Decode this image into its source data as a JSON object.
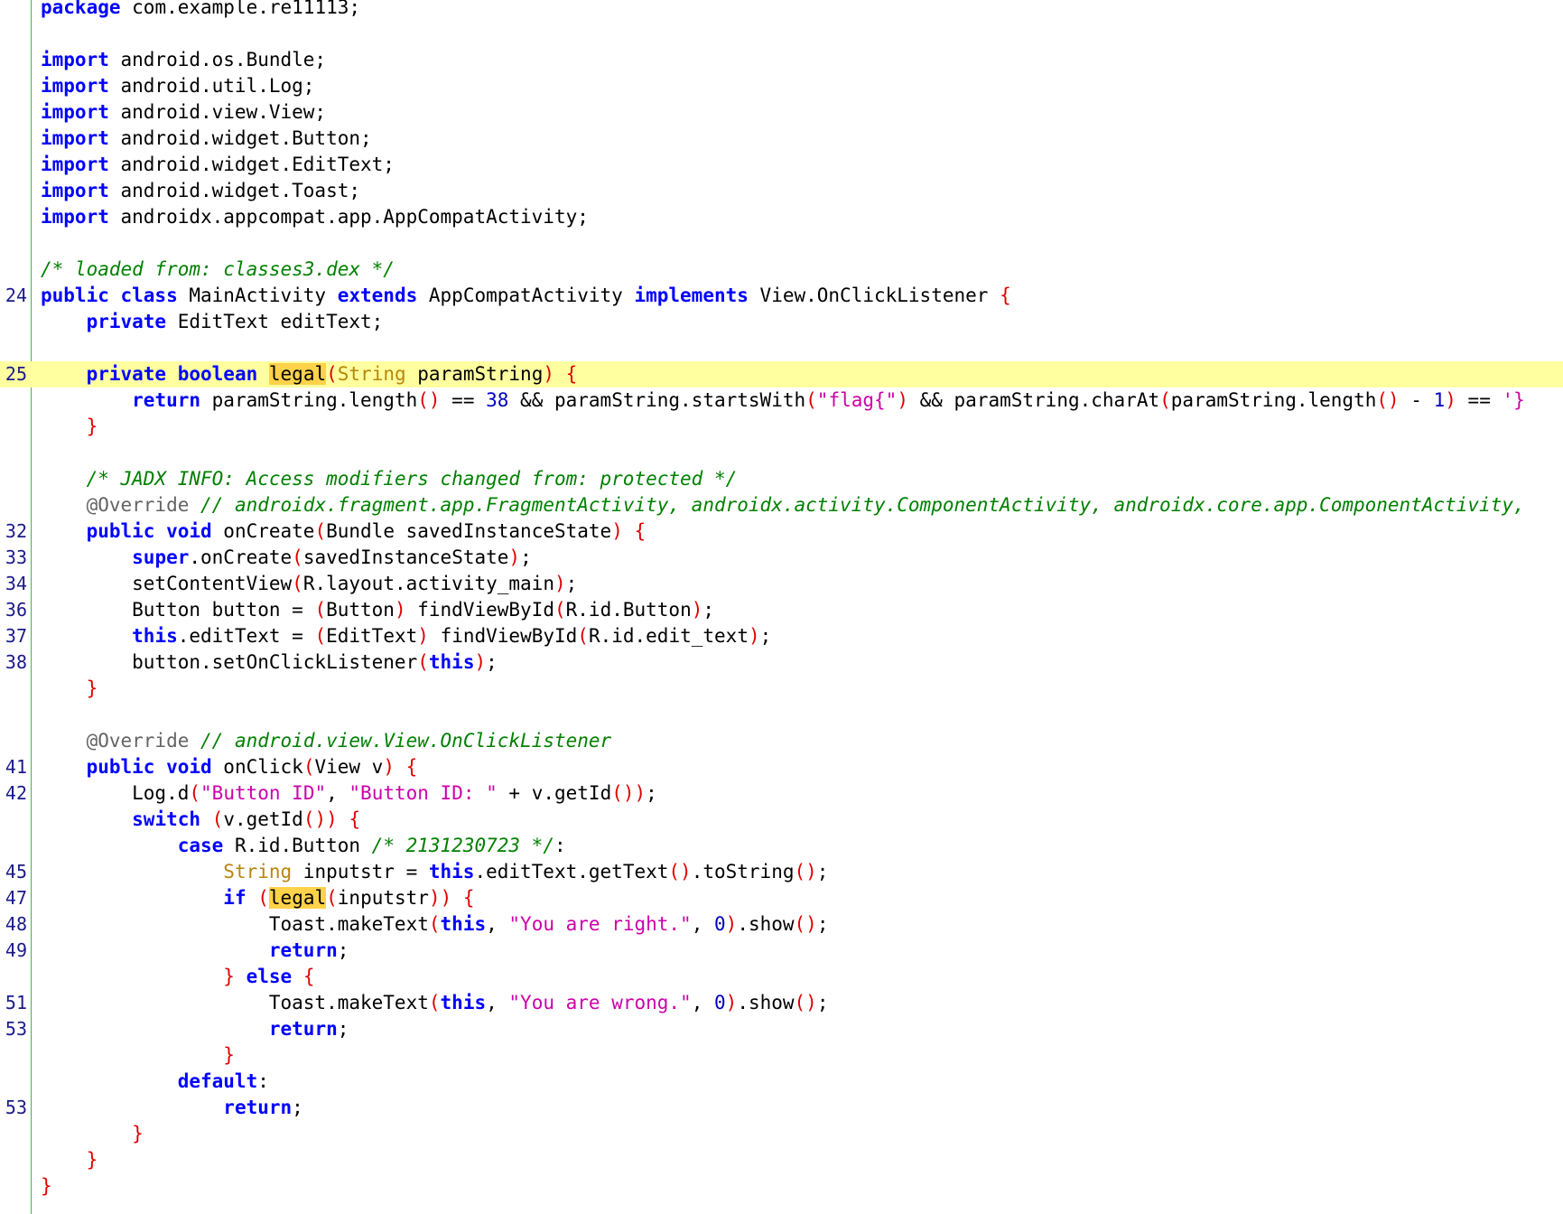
{
  "editor": {
    "lines": [
      {
        "ln": "",
        "tokens": [
          {
            "k": "kw",
            "t": "package"
          },
          {
            "k": "",
            "t": " com.example.re11113;"
          }
        ]
      },
      {
        "ln": "",
        "tokens": []
      },
      {
        "ln": "",
        "tokens": [
          {
            "k": "kw",
            "t": "import"
          },
          {
            "k": "",
            "t": " android.os.Bundle;"
          }
        ]
      },
      {
        "ln": "",
        "tokens": [
          {
            "k": "kw",
            "t": "import"
          },
          {
            "k": "",
            "t": " android.util.Log;"
          }
        ]
      },
      {
        "ln": "",
        "tokens": [
          {
            "k": "kw",
            "t": "import"
          },
          {
            "k": "",
            "t": " android.view.View;"
          }
        ]
      },
      {
        "ln": "",
        "tokens": [
          {
            "k": "kw",
            "t": "import"
          },
          {
            "k": "",
            "t": " android.widget.Button;"
          }
        ]
      },
      {
        "ln": "",
        "tokens": [
          {
            "k": "kw",
            "t": "import"
          },
          {
            "k": "",
            "t": " android.widget.EditText;"
          }
        ]
      },
      {
        "ln": "",
        "tokens": [
          {
            "k": "kw",
            "t": "import"
          },
          {
            "k": "",
            "t": " android.widget.Toast;"
          }
        ]
      },
      {
        "ln": "",
        "tokens": [
          {
            "k": "kw",
            "t": "import"
          },
          {
            "k": "",
            "t": " androidx.appcompat.app.AppCompatActivity;"
          }
        ]
      },
      {
        "ln": "",
        "tokens": []
      },
      {
        "ln": "",
        "tokens": [
          {
            "k": "cm",
            "t": "/* loaded from: classes3.dex */"
          }
        ]
      },
      {
        "ln": "24",
        "tokens": [
          {
            "k": "kw",
            "t": "public class"
          },
          {
            "k": "",
            "t": " MainActivity "
          },
          {
            "k": "kw",
            "t": "extends"
          },
          {
            "k": "",
            "t": " AppCompatActivity "
          },
          {
            "k": "kw",
            "t": "implements"
          },
          {
            "k": "",
            "t": " View.OnClickListener "
          },
          {
            "k": "br",
            "t": "{"
          }
        ]
      },
      {
        "ln": "",
        "tokens": [
          {
            "k": "",
            "t": "    "
          },
          {
            "k": "kw",
            "t": "private"
          },
          {
            "k": "",
            "t": " EditText editText;"
          }
        ]
      },
      {
        "ln": "",
        "tokens": []
      },
      {
        "ln": "25",
        "hl": true,
        "tokens": [
          {
            "k": "",
            "t": "    "
          },
          {
            "k": "kw",
            "t": "private boolean"
          },
          {
            "k": "",
            "t": " "
          },
          {
            "k": "mark",
            "t": "legal"
          },
          {
            "k": "par",
            "t": "("
          },
          {
            "k": "typ",
            "t": "String"
          },
          {
            "k": "",
            "t": " paramString"
          },
          {
            "k": "par",
            "t": ")"
          },
          {
            "k": "",
            "t": " "
          },
          {
            "k": "br",
            "t": "{"
          }
        ]
      },
      {
        "ln": "",
        "tokens": [
          {
            "k": "",
            "t": "        "
          },
          {
            "k": "kw",
            "t": "return"
          },
          {
            "k": "",
            "t": " paramString.length"
          },
          {
            "k": "par",
            "t": "()"
          },
          {
            "k": "",
            "t": " == "
          },
          {
            "k": "num",
            "t": "38"
          },
          {
            "k": "",
            "t": " && paramString.startsWith"
          },
          {
            "k": "par",
            "t": "("
          },
          {
            "k": "st",
            "t": "\"flag{\""
          },
          {
            "k": "par",
            "t": ")"
          },
          {
            "k": "",
            "t": " && paramString.charAt"
          },
          {
            "k": "par",
            "t": "("
          },
          {
            "k": "",
            "t": "paramString.length"
          },
          {
            "k": "par",
            "t": "()"
          },
          {
            "k": "",
            "t": " - "
          },
          {
            "k": "num",
            "t": "1"
          },
          {
            "k": "par",
            "t": ")"
          },
          {
            "k": "",
            "t": " == "
          },
          {
            "k": "st",
            "t": "'}"
          }
        ]
      },
      {
        "ln": "",
        "tokens": [
          {
            "k": "",
            "t": "    "
          },
          {
            "k": "br",
            "t": "}"
          }
        ]
      },
      {
        "ln": "",
        "tokens": []
      },
      {
        "ln": "",
        "tokens": [
          {
            "k": "",
            "t": "    "
          },
          {
            "k": "cm",
            "t": "/* JADX INFO: Access modifiers changed from: protected */"
          }
        ]
      },
      {
        "ln": "",
        "tokens": [
          {
            "k": "",
            "t": "    "
          },
          {
            "k": "ann",
            "t": "@Override"
          },
          {
            "k": "",
            "t": " "
          },
          {
            "k": "cm",
            "t": "// androidx.fragment.app.FragmentActivity, androidx.activity.ComponentActivity, androidx.core.app.ComponentActivity,"
          }
        ]
      },
      {
        "ln": "32",
        "tokens": [
          {
            "k": "",
            "t": "    "
          },
          {
            "k": "kw",
            "t": "public void"
          },
          {
            "k": "",
            "t": " onCreate"
          },
          {
            "k": "par",
            "t": "("
          },
          {
            "k": "",
            "t": "Bundle savedInstanceState"
          },
          {
            "k": "par",
            "t": ")"
          },
          {
            "k": "",
            "t": " "
          },
          {
            "k": "br",
            "t": "{"
          }
        ]
      },
      {
        "ln": "33",
        "tokens": [
          {
            "k": "",
            "t": "        "
          },
          {
            "k": "kw",
            "t": "super"
          },
          {
            "k": "",
            "t": ".onCreate"
          },
          {
            "k": "par",
            "t": "("
          },
          {
            "k": "",
            "t": "savedInstanceState"
          },
          {
            "k": "par",
            "t": ")"
          },
          {
            "k": "",
            "t": ";"
          }
        ]
      },
      {
        "ln": "34",
        "tokens": [
          {
            "k": "",
            "t": "        setContentView"
          },
          {
            "k": "par",
            "t": "("
          },
          {
            "k": "",
            "t": "R.layout.activity_main"
          },
          {
            "k": "par",
            "t": ")"
          },
          {
            "k": "",
            "t": ";"
          }
        ]
      },
      {
        "ln": "36",
        "tokens": [
          {
            "k": "",
            "t": "        Button button = "
          },
          {
            "k": "par",
            "t": "("
          },
          {
            "k": "",
            "t": "Button"
          },
          {
            "k": "par",
            "t": ")"
          },
          {
            "k": "",
            "t": " findViewById"
          },
          {
            "k": "par",
            "t": "("
          },
          {
            "k": "",
            "t": "R.id.Button"
          },
          {
            "k": "par",
            "t": ")"
          },
          {
            "k": "",
            "t": ";"
          }
        ]
      },
      {
        "ln": "37",
        "tokens": [
          {
            "k": "",
            "t": "        "
          },
          {
            "k": "kw",
            "t": "this"
          },
          {
            "k": "",
            "t": ".editText = "
          },
          {
            "k": "par",
            "t": "("
          },
          {
            "k": "",
            "t": "EditText"
          },
          {
            "k": "par",
            "t": ")"
          },
          {
            "k": "",
            "t": " findViewById"
          },
          {
            "k": "par",
            "t": "("
          },
          {
            "k": "",
            "t": "R.id.edit_text"
          },
          {
            "k": "par",
            "t": ")"
          },
          {
            "k": "",
            "t": ";"
          }
        ]
      },
      {
        "ln": "38",
        "tokens": [
          {
            "k": "",
            "t": "        button.setOnClickListener"
          },
          {
            "k": "par",
            "t": "("
          },
          {
            "k": "kw",
            "t": "this"
          },
          {
            "k": "par",
            "t": ")"
          },
          {
            "k": "",
            "t": ";"
          }
        ]
      },
      {
        "ln": "",
        "tokens": [
          {
            "k": "",
            "t": "    "
          },
          {
            "k": "br",
            "t": "}"
          }
        ]
      },
      {
        "ln": "",
        "tokens": []
      },
      {
        "ln": "",
        "tokens": [
          {
            "k": "",
            "t": "    "
          },
          {
            "k": "ann",
            "t": "@Override"
          },
          {
            "k": "",
            "t": " "
          },
          {
            "k": "cm",
            "t": "// android.view.View.OnClickListener"
          }
        ]
      },
      {
        "ln": "41",
        "tokens": [
          {
            "k": "",
            "t": "    "
          },
          {
            "k": "kw",
            "t": "public void"
          },
          {
            "k": "",
            "t": " onClick"
          },
          {
            "k": "par",
            "t": "("
          },
          {
            "k": "",
            "t": "View v"
          },
          {
            "k": "par",
            "t": ")"
          },
          {
            "k": "",
            "t": " "
          },
          {
            "k": "br",
            "t": "{"
          }
        ]
      },
      {
        "ln": "42",
        "tokens": [
          {
            "k": "",
            "t": "        Log.d"
          },
          {
            "k": "par",
            "t": "("
          },
          {
            "k": "st",
            "t": "\"Button ID\""
          },
          {
            "k": "",
            "t": ", "
          },
          {
            "k": "st",
            "t": "\"Button ID: \""
          },
          {
            "k": "",
            "t": " + v.getId"
          },
          {
            "k": "par",
            "t": "())"
          },
          {
            "k": "",
            "t": ";"
          }
        ]
      },
      {
        "ln": "",
        "tokens": [
          {
            "k": "",
            "t": "        "
          },
          {
            "k": "kw",
            "t": "switch"
          },
          {
            "k": "",
            "t": " "
          },
          {
            "k": "par",
            "t": "("
          },
          {
            "k": "",
            "t": "v.getId"
          },
          {
            "k": "par",
            "t": "())"
          },
          {
            "k": "",
            "t": " "
          },
          {
            "k": "br",
            "t": "{"
          }
        ]
      },
      {
        "ln": "",
        "tokens": [
          {
            "k": "",
            "t": "            "
          },
          {
            "k": "kw",
            "t": "case"
          },
          {
            "k": "",
            "t": " R.id.Button "
          },
          {
            "k": "cm",
            "t": "/* 2131230723 */"
          },
          {
            "k": "",
            "t": ":"
          }
        ]
      },
      {
        "ln": "45",
        "tokens": [
          {
            "k": "",
            "t": "                "
          },
          {
            "k": "typ",
            "t": "String"
          },
          {
            "k": "",
            "t": " inputstr = "
          },
          {
            "k": "kw",
            "t": "this"
          },
          {
            "k": "",
            "t": ".editText.getText"
          },
          {
            "k": "par",
            "t": "()"
          },
          {
            "k": "",
            "t": ".toString"
          },
          {
            "k": "par",
            "t": "()"
          },
          {
            "k": "",
            "t": ";"
          }
        ]
      },
      {
        "ln": "47",
        "tokens": [
          {
            "k": "",
            "t": "                "
          },
          {
            "k": "kw",
            "t": "if"
          },
          {
            "k": "",
            "t": " "
          },
          {
            "k": "par",
            "t": "("
          },
          {
            "k": "mark",
            "t": "legal"
          },
          {
            "k": "par",
            "t": "("
          },
          {
            "k": "",
            "t": "inputstr"
          },
          {
            "k": "par",
            "t": "))"
          },
          {
            "k": "",
            "t": " "
          },
          {
            "k": "br",
            "t": "{"
          }
        ]
      },
      {
        "ln": "48",
        "tokens": [
          {
            "k": "",
            "t": "                    Toast.makeText"
          },
          {
            "k": "par",
            "t": "("
          },
          {
            "k": "kw",
            "t": "this"
          },
          {
            "k": "",
            "t": ", "
          },
          {
            "k": "st",
            "t": "\"You are right.\""
          },
          {
            "k": "",
            "t": ", "
          },
          {
            "k": "num",
            "t": "0"
          },
          {
            "k": "par",
            "t": ")"
          },
          {
            "k": "",
            "t": ".show"
          },
          {
            "k": "par",
            "t": "()"
          },
          {
            "k": "",
            "t": ";"
          }
        ]
      },
      {
        "ln": "49",
        "tokens": [
          {
            "k": "",
            "t": "                    "
          },
          {
            "k": "kw",
            "t": "return"
          },
          {
            "k": "",
            "t": ";"
          }
        ]
      },
      {
        "ln": "",
        "tokens": [
          {
            "k": "",
            "t": "                "
          },
          {
            "k": "br",
            "t": "}"
          },
          {
            "k": "",
            "t": " "
          },
          {
            "k": "kw",
            "t": "else"
          },
          {
            "k": "",
            "t": " "
          },
          {
            "k": "br",
            "t": "{"
          }
        ]
      },
      {
        "ln": "51",
        "tokens": [
          {
            "k": "",
            "t": "                    Toast.makeText"
          },
          {
            "k": "par",
            "t": "("
          },
          {
            "k": "kw",
            "t": "this"
          },
          {
            "k": "",
            "t": ", "
          },
          {
            "k": "st",
            "t": "\"You are wrong.\""
          },
          {
            "k": "",
            "t": ", "
          },
          {
            "k": "num",
            "t": "0"
          },
          {
            "k": "par",
            "t": ")"
          },
          {
            "k": "",
            "t": ".show"
          },
          {
            "k": "par",
            "t": "()"
          },
          {
            "k": "",
            "t": ";"
          }
        ]
      },
      {
        "ln": "53",
        "tokens": [
          {
            "k": "",
            "t": "                    "
          },
          {
            "k": "kw",
            "t": "return"
          },
          {
            "k": "",
            "t": ";"
          }
        ]
      },
      {
        "ln": "",
        "tokens": [
          {
            "k": "",
            "t": "                "
          },
          {
            "k": "br",
            "t": "}"
          }
        ]
      },
      {
        "ln": "",
        "tokens": [
          {
            "k": "",
            "t": "            "
          },
          {
            "k": "kw",
            "t": "default"
          },
          {
            "k": "",
            "t": ":"
          }
        ]
      },
      {
        "ln": "53",
        "tokens": [
          {
            "k": "",
            "t": "                "
          },
          {
            "k": "kw",
            "t": "return"
          },
          {
            "k": "",
            "t": ";"
          }
        ]
      },
      {
        "ln": "",
        "tokens": [
          {
            "k": "",
            "t": "        "
          },
          {
            "k": "br",
            "t": "}"
          }
        ]
      },
      {
        "ln": "",
        "tokens": [
          {
            "k": "",
            "t": "    "
          },
          {
            "k": "br",
            "t": "}"
          }
        ]
      },
      {
        "ln": "",
        "tokens": [
          {
            "k": "br",
            "t": "}"
          }
        ]
      }
    ]
  },
  "colors": {
    "keyword": "#0000ff",
    "comment": "#008000",
    "string": "#cc00aa",
    "bracket": "#e00000",
    "highlight_line": "#ffffa0",
    "highlight_word": "#ffd24a",
    "gutter_border": "#4caf50"
  }
}
